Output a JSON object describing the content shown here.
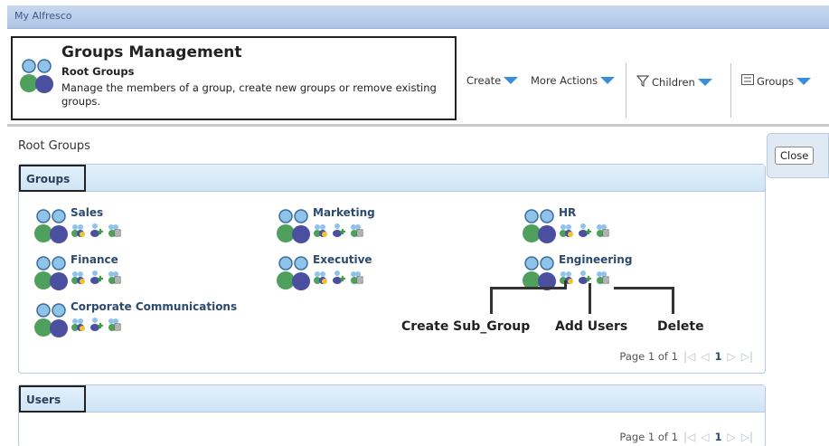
{
  "topbar": {
    "title": "My Alfresco"
  },
  "header": {
    "title": "Groups Management",
    "subtitle": "Root Groups",
    "description": "Manage the members of a group, create new groups or remove existing groups.",
    "actions": [
      {
        "label": "Create",
        "icon": "none"
      },
      {
        "label": "More Actions",
        "icon": "none"
      },
      {
        "label": "Children",
        "icon": "filter-icon"
      },
      {
        "label": "Groups",
        "icon": "list-icon"
      }
    ]
  },
  "close_label": "Close",
  "section_title": "Root Groups",
  "groups_panel": {
    "label": "Groups",
    "groups": [
      {
        "name": "Sales"
      },
      {
        "name": "Marketing"
      },
      {
        "name": "HR"
      },
      {
        "name": "Finance"
      },
      {
        "name": "Executive"
      },
      {
        "name": "Engineering"
      },
      {
        "name": "Corporate Communications"
      }
    ],
    "pager": {
      "text": "Page 1 of 1",
      "current": "1"
    }
  },
  "annotations": {
    "create": "Create Sub_Group",
    "add": "Add Users",
    "delete": "Delete"
  },
  "users_panel": {
    "label": "Users",
    "pager": {
      "text": "Page 1 of 1",
      "current": "1"
    }
  },
  "colors": {
    "accent": "#3a8fd8",
    "panel_header": "#cfe4f6",
    "link": "#2b4a6f"
  }
}
